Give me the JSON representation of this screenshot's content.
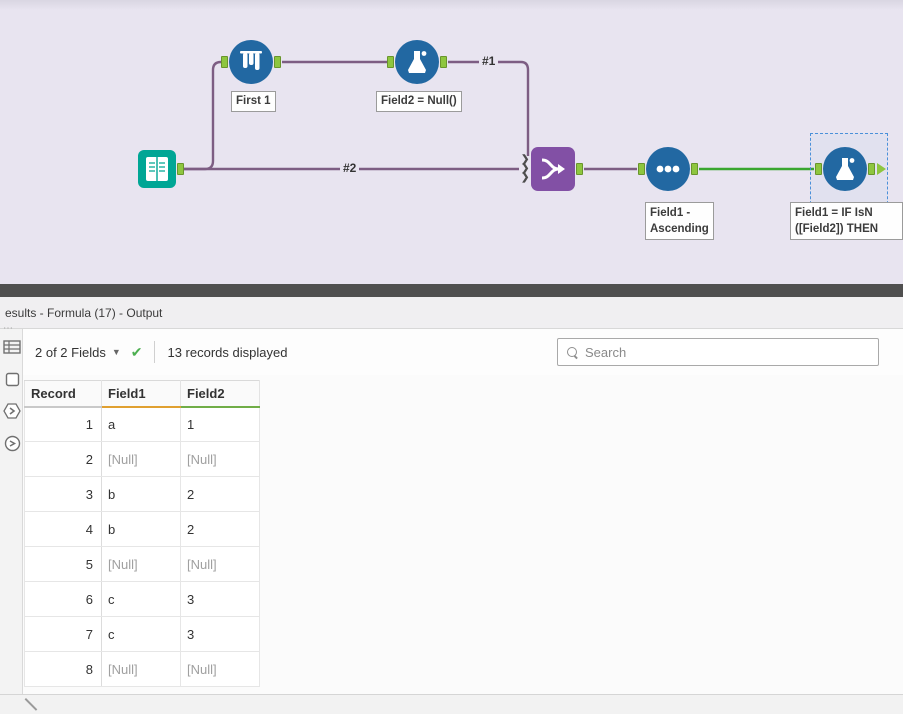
{
  "canvas": {
    "wires": {
      "label_1": "#1",
      "label_2": "#2"
    },
    "tools": {
      "sample_label": "First 1",
      "formula1_label": "Field2 = Null()",
      "sort_label_1": "Field1 -",
      "sort_label_2": "Ascending",
      "formula2_label_1": "Field1 = IF IsN",
      "formula2_label_2": "([Field2]) THEN"
    }
  },
  "results": {
    "title": "esults - Formula (17) - Output",
    "toolbar": {
      "fields": "2 of 2 Fields",
      "records": "13 records displayed",
      "search_placeholder": "Search"
    },
    "table": {
      "columns": [
        "Record",
        "Field1",
        "Field2"
      ],
      "rows": [
        [
          "1",
          "a",
          "1"
        ],
        [
          "2",
          "[Null]",
          "[Null]"
        ],
        [
          "3",
          "b",
          "2"
        ],
        [
          "4",
          "b",
          "2"
        ],
        [
          "5",
          "[Null]",
          "[Null]"
        ],
        [
          "6",
          "c",
          "3"
        ],
        [
          "7",
          "c",
          "3"
        ],
        [
          "8",
          "[Null]",
          "[Null]"
        ]
      ]
    }
  },
  "icons": {
    "dropdown_caret": "▼",
    "check": "✔",
    "union_input_chevron": "❯"
  },
  "colors": {
    "anchor_green": "#8ec63f",
    "wire_purple": "#7d5d83",
    "wire_green": "#3aa62f",
    "field1_underline": "#e0a030",
    "field2_underline": "#70ad47",
    "input_tool": "#00a695",
    "blue_tool": "#2268a2",
    "union_tool": "#8250a5"
  }
}
